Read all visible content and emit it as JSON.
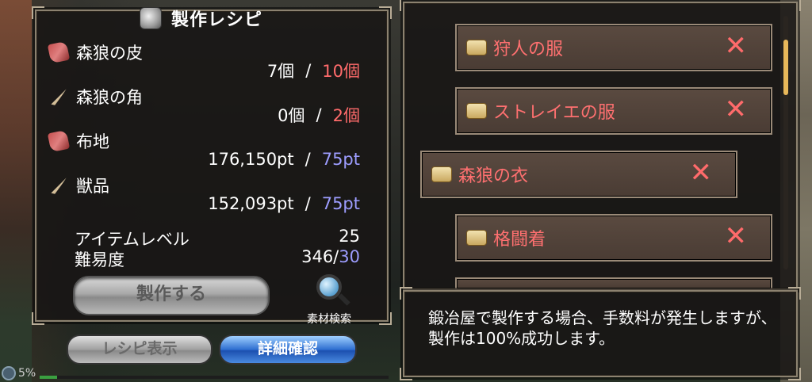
{
  "title": "製作レシピ",
  "materials": [
    {
      "name": "森狼の皮",
      "icon": "hide-icon",
      "have": "7個",
      "need": "10個",
      "need_color": "red"
    },
    {
      "name": "森狼の角",
      "icon": "horn-icon",
      "have": "0個",
      "need": "2個",
      "need_color": "red"
    },
    {
      "name": "布地",
      "icon": "hide-icon",
      "have": "176,150pt",
      "need": "75pt",
      "need_color": "blue"
    },
    {
      "name": "獣品",
      "icon": "horn-icon",
      "have": "152,093pt",
      "need": "75pt",
      "need_color": "blue"
    }
  ],
  "separator": "/",
  "stats": {
    "item_level_label": "アイテムレベル",
    "item_level_value": "25",
    "difficulty_label": "難易度",
    "difficulty_value": "346/",
    "difficulty_max": "30"
  },
  "buttons": {
    "make": "製作する",
    "search": "素材検索",
    "recipe_display": "レシピ表示",
    "detail_confirm": "詳細確認"
  },
  "recipes": [
    {
      "name": "狩人の服",
      "selected": false
    },
    {
      "name": "ストレイエの服",
      "selected": false
    },
    {
      "name": "森狼の衣",
      "selected": true
    },
    {
      "name": "格闘着",
      "selected": false
    }
  ],
  "remove_mark": "✕",
  "message": "鍛冶屋で製作する場合、手数料が発生しますが、製作は100%成功します。",
  "status": {
    "battery_percent": "5%",
    "battery_level": 0.05
  },
  "colors": {
    "accent_red": "#ff6b6b",
    "accent_blue": "#9d9dff"
  }
}
